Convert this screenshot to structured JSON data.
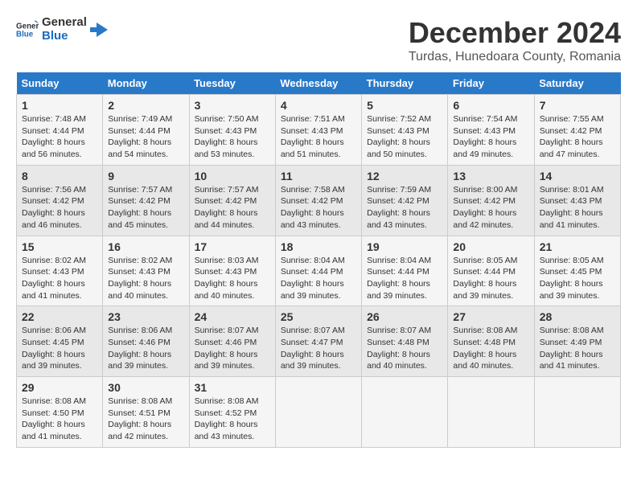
{
  "header": {
    "logo_general": "General",
    "logo_blue": "Blue",
    "month_title": "December 2024",
    "location": "Turdas, Hunedoara County, Romania"
  },
  "calendar": {
    "days_of_week": [
      "Sunday",
      "Monday",
      "Tuesday",
      "Wednesday",
      "Thursday",
      "Friday",
      "Saturday"
    ],
    "weeks": [
      [
        {
          "day": "1",
          "sunrise": "7:48 AM",
          "sunset": "4:44 PM",
          "daylight": "8 hours and 56 minutes."
        },
        {
          "day": "2",
          "sunrise": "7:49 AM",
          "sunset": "4:44 PM",
          "daylight": "8 hours and 54 minutes."
        },
        {
          "day": "3",
          "sunrise": "7:50 AM",
          "sunset": "4:43 PM",
          "daylight": "8 hours and 53 minutes."
        },
        {
          "day": "4",
          "sunrise": "7:51 AM",
          "sunset": "4:43 PM",
          "daylight": "8 hours and 51 minutes."
        },
        {
          "day": "5",
          "sunrise": "7:52 AM",
          "sunset": "4:43 PM",
          "daylight": "8 hours and 50 minutes."
        },
        {
          "day": "6",
          "sunrise": "7:54 AM",
          "sunset": "4:43 PM",
          "daylight": "8 hours and 49 minutes."
        },
        {
          "day": "7",
          "sunrise": "7:55 AM",
          "sunset": "4:42 PM",
          "daylight": "8 hours and 47 minutes."
        }
      ],
      [
        {
          "day": "8",
          "sunrise": "7:56 AM",
          "sunset": "4:42 PM",
          "daylight": "8 hours and 46 minutes."
        },
        {
          "day": "9",
          "sunrise": "7:57 AM",
          "sunset": "4:42 PM",
          "daylight": "8 hours and 45 minutes."
        },
        {
          "day": "10",
          "sunrise": "7:57 AM",
          "sunset": "4:42 PM",
          "daylight": "8 hours and 44 minutes."
        },
        {
          "day": "11",
          "sunrise": "7:58 AM",
          "sunset": "4:42 PM",
          "daylight": "8 hours and 43 minutes."
        },
        {
          "day": "12",
          "sunrise": "7:59 AM",
          "sunset": "4:42 PM",
          "daylight": "8 hours and 43 minutes."
        },
        {
          "day": "13",
          "sunrise": "8:00 AM",
          "sunset": "4:42 PM",
          "daylight": "8 hours and 42 minutes."
        },
        {
          "day": "14",
          "sunrise": "8:01 AM",
          "sunset": "4:43 PM",
          "daylight": "8 hours and 41 minutes."
        }
      ],
      [
        {
          "day": "15",
          "sunrise": "8:02 AM",
          "sunset": "4:43 PM",
          "daylight": "8 hours and 41 minutes."
        },
        {
          "day": "16",
          "sunrise": "8:02 AM",
          "sunset": "4:43 PM",
          "daylight": "8 hours and 40 minutes."
        },
        {
          "day": "17",
          "sunrise": "8:03 AM",
          "sunset": "4:43 PM",
          "daylight": "8 hours and 40 minutes."
        },
        {
          "day": "18",
          "sunrise": "8:04 AM",
          "sunset": "4:44 PM",
          "daylight": "8 hours and 39 minutes."
        },
        {
          "day": "19",
          "sunrise": "8:04 AM",
          "sunset": "4:44 PM",
          "daylight": "8 hours and 39 minutes."
        },
        {
          "day": "20",
          "sunrise": "8:05 AM",
          "sunset": "4:44 PM",
          "daylight": "8 hours and 39 minutes."
        },
        {
          "day": "21",
          "sunrise": "8:05 AM",
          "sunset": "4:45 PM",
          "daylight": "8 hours and 39 minutes."
        }
      ],
      [
        {
          "day": "22",
          "sunrise": "8:06 AM",
          "sunset": "4:45 PM",
          "daylight": "8 hours and 39 minutes."
        },
        {
          "day": "23",
          "sunrise": "8:06 AM",
          "sunset": "4:46 PM",
          "daylight": "8 hours and 39 minutes."
        },
        {
          "day": "24",
          "sunrise": "8:07 AM",
          "sunset": "4:46 PM",
          "daylight": "8 hours and 39 minutes."
        },
        {
          "day": "25",
          "sunrise": "8:07 AM",
          "sunset": "4:47 PM",
          "daylight": "8 hours and 39 minutes."
        },
        {
          "day": "26",
          "sunrise": "8:07 AM",
          "sunset": "4:48 PM",
          "daylight": "8 hours and 40 minutes."
        },
        {
          "day": "27",
          "sunrise": "8:08 AM",
          "sunset": "4:48 PM",
          "daylight": "8 hours and 40 minutes."
        },
        {
          "day": "28",
          "sunrise": "8:08 AM",
          "sunset": "4:49 PM",
          "daylight": "8 hours and 41 minutes."
        }
      ],
      [
        {
          "day": "29",
          "sunrise": "8:08 AM",
          "sunset": "4:50 PM",
          "daylight": "8 hours and 41 minutes."
        },
        {
          "day": "30",
          "sunrise": "8:08 AM",
          "sunset": "4:51 PM",
          "daylight": "8 hours and 42 minutes."
        },
        {
          "day": "31",
          "sunrise": "8:08 AM",
          "sunset": "4:52 PM",
          "daylight": "8 hours and 43 minutes."
        },
        null,
        null,
        null,
        null
      ]
    ]
  }
}
